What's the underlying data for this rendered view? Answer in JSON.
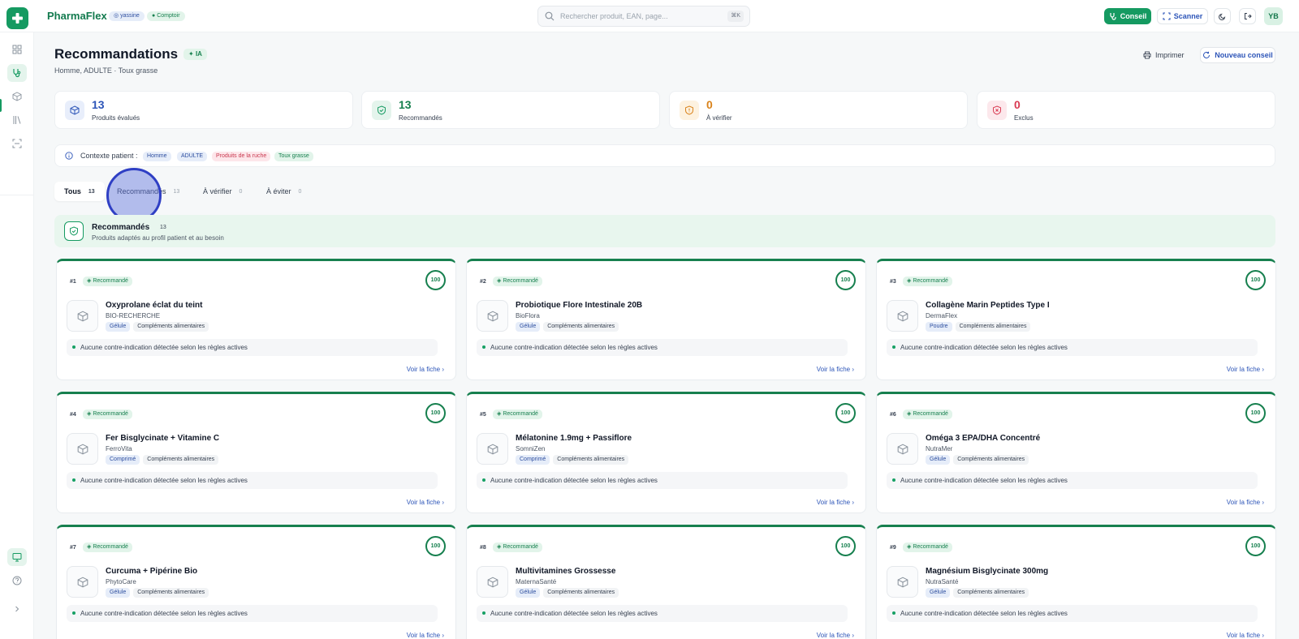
{
  "app": {
    "brand": "PharmaFlex",
    "user": "yassine",
    "role": "Comptoir",
    "search_placeholder": "Rechercher produit, EAN, page...",
    "search_shortcut": "⌘K",
    "conseil_label": "Conseil",
    "scanner_label": "Scanner",
    "avatar_initials": "YB"
  },
  "colors": {
    "brand_green": "#159a61",
    "link_blue": "#2d55b8",
    "warning_orange": "#d9821a",
    "danger_red": "#d93a52"
  },
  "header": {
    "title": "Recommandations",
    "badge": "IA",
    "subtitle": "Homme, ADULTE · Toux grasse",
    "print_label": "Imprimer",
    "new_label": "Nouveau conseil"
  },
  "stats": [
    {
      "value": "13",
      "label": "Produits évalués"
    },
    {
      "value": "13",
      "label": "Recommandés"
    },
    {
      "value": "0",
      "label": "À vérifier"
    },
    {
      "value": "0",
      "label": "Exclus"
    }
  ],
  "context": {
    "label": "Contexte patient :",
    "tags": [
      "Homme",
      "ADULTE",
      "Produits de la ruche",
      "Toux grasse"
    ]
  },
  "tabs": [
    {
      "label": "Tous",
      "count": "13"
    },
    {
      "label": "Recommandés",
      "count": "13"
    },
    {
      "label": "À vérifier",
      "count": "0"
    },
    {
      "label": "À éviter",
      "count": "0"
    }
  ],
  "section": {
    "title": "Recommandés",
    "count": "13",
    "description": "Produits adaptés au profil patient et au besoin"
  },
  "card_common": {
    "badge": "Recommandé",
    "score": "100",
    "note": "Aucune contre-indication détectée selon les règles actives",
    "link": "Voir la fiche"
  },
  "products": [
    {
      "rank": "#1",
      "name": "Oxyprolane éclat du teint",
      "brand": "BIO-RECHERCHE",
      "form": "Gélule",
      "category": "Compléments alimentaires"
    },
    {
      "rank": "#2",
      "name": "Probiotique Flore Intestinale 20B",
      "brand": "BioFlora",
      "form": "Gélule",
      "category": "Compléments alimentaires"
    },
    {
      "rank": "#3",
      "name": "Collagène Marin Peptides Type I",
      "brand": "DermaFlex",
      "form": "Poudre",
      "category": "Compléments alimentaires"
    },
    {
      "rank": "#4",
      "name": "Fer Bisglycinate + Vitamine C",
      "brand": "FerroVita",
      "form": "Comprimé",
      "category": "Compléments alimentaires"
    },
    {
      "rank": "#5",
      "name": "Mélatonine 1.9mg + Passiflore",
      "brand": "SomniZen",
      "form": "Comprimé",
      "category": "Compléments alimentaires"
    },
    {
      "rank": "#6",
      "name": "Oméga 3 EPA/DHA Concentré",
      "brand": "NutraMer",
      "form": "Gélule",
      "category": "Compléments alimentaires"
    },
    {
      "rank": "#7",
      "name": "Curcuma + Pipérine Bio",
      "brand": "PhytoCare",
      "form": "Gélule",
      "category": "Compléments alimentaires"
    },
    {
      "rank": "#8",
      "name": "Multivitamines Grossesse",
      "brand": "MaternaSanté",
      "form": "Gélule",
      "category": "Compléments alimentaires"
    },
    {
      "rank": "#9",
      "name": "Magnésium Bisglycinate 300mg",
      "brand": "NutraSanté",
      "form": "Gélule",
      "category": "Compléments alimentaires"
    }
  ]
}
